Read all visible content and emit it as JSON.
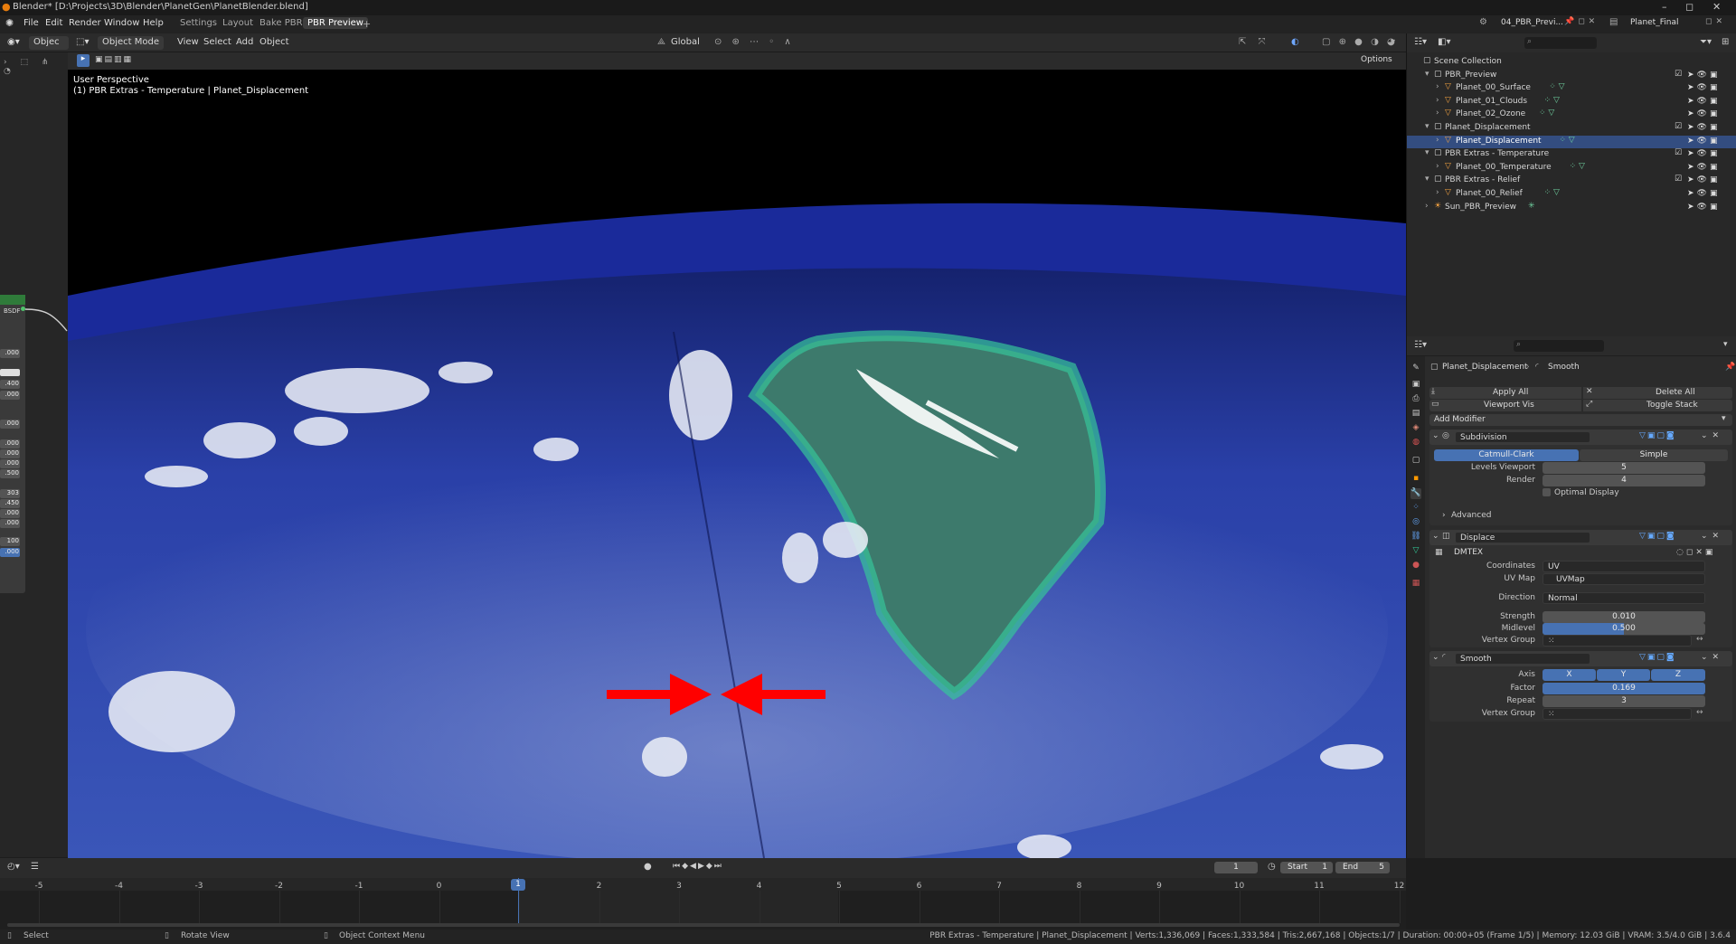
{
  "window": {
    "title": "Blender* [D:\\Projects\\3D\\Blender\\PlanetGen\\PlanetBlender.blend]",
    "minimize": "–",
    "maximize": "◻",
    "close": "✕"
  },
  "menubar": {
    "items": [
      "File",
      "Edit",
      "Render",
      "Window",
      "Help"
    ],
    "workspaces": [
      "Settings",
      "Layout",
      "Bake PBR",
      "PBR Preview"
    ],
    "active_workspace": "PBR Preview",
    "add_tab": "+",
    "scene_name": "04_PBR_Previ...",
    "view_layer": "Planet_Final"
  },
  "viewport_header": {
    "mode": "Object Mode",
    "mode_short": "Objec",
    "view": "View",
    "select": "Select",
    "add": "Add",
    "object": "Object",
    "transform_orientation": "Global",
    "options": "Options"
  },
  "viewport": {
    "perspective_label": "User Perspective",
    "object_label": "(1) PBR Extras - Temperature | Planet_Displacement"
  },
  "node_editor_strip": {
    "socket_label": "BSDF",
    "values": [
      ".000",
      ".400",
      ".000",
      ".000",
      ".000",
      ".000",
      ".000",
      ".500",
      "303",
      ".450",
      ".000",
      ".000",
      "100",
      ".000"
    ]
  },
  "outliner": {
    "search_placeholder": "",
    "rows": [
      {
        "label": "Scene Collection",
        "indent": 0,
        "type": "scene"
      },
      {
        "label": "PBR_Preview",
        "indent": 1,
        "type": "collection"
      },
      {
        "label": "Planet_00_Surface",
        "indent": 2,
        "type": "object"
      },
      {
        "label": "Planet_01_Clouds",
        "indent": 2,
        "type": "object"
      },
      {
        "label": "Planet_02_Ozone",
        "indent": 2,
        "type": "object"
      },
      {
        "label": "Planet_Displacement",
        "indent": 1,
        "type": "collection"
      },
      {
        "label": "Planet_Displacement",
        "indent": 2,
        "type": "object",
        "selected": true
      },
      {
        "label": "PBR Extras - Temperature",
        "indent": 1,
        "type": "collection"
      },
      {
        "label": "Planet_00_Temperature",
        "indent": 2,
        "type": "object"
      },
      {
        "label": "PBR Extras - Relief",
        "indent": 1,
        "type": "collection"
      },
      {
        "label": "Planet_00_Relief",
        "indent": 2,
        "type": "object"
      },
      {
        "label": "Sun_PBR_Preview",
        "indent": 1,
        "type": "light"
      }
    ]
  },
  "properties": {
    "breadcrumb_object": "Planet_Displacement",
    "breadcrumb_modifier": "Smooth",
    "apply_all": "Apply All",
    "delete_all": "Delete All",
    "viewport_vis": "Viewport Vis",
    "toggle_stack": "Toggle Stack",
    "add_modifier": "Add Modifier",
    "subdivision": {
      "name": "Subdivision",
      "catmull_clark": "Catmull-Clark",
      "simple": "Simple",
      "levels_viewport_label": "Levels Viewport",
      "levels_viewport": "5",
      "render_label": "Render",
      "render": "4",
      "optimal_display": "Optimal Display",
      "advanced": "Advanced"
    },
    "displace": {
      "name": "Displace",
      "texture": "DMTEX",
      "coordinates_label": "Coordinates",
      "coordinates": "UV",
      "uv_map_label": "UV Map",
      "uv_map": "UVMap",
      "direction_label": "Direction",
      "direction": "Normal",
      "strength_label": "Strength",
      "strength": "0.010",
      "midlevel_label": "Midlevel",
      "midlevel": "0.500",
      "midlevel_fraction": 0.5,
      "vertex_group_label": "Vertex Group"
    },
    "smooth": {
      "name": "Smooth",
      "axis_label": "Axis",
      "axes": [
        "X",
        "Y",
        "Z"
      ],
      "factor_label": "Factor",
      "factor": "0.169",
      "repeat_label": "Repeat",
      "repeat": "3",
      "vertex_group_label": "Vertex Group"
    }
  },
  "timeline": {
    "current_frame": "1",
    "start_label": "Start",
    "start": "1",
    "end_label": "End",
    "end": "5",
    "ticks": [
      "-5",
      "-4",
      "-3",
      "-2",
      "-1",
      "0",
      "1",
      "2",
      "3",
      "4",
      "5",
      "6",
      "7",
      "8",
      "9",
      "10",
      "11",
      "12"
    ]
  },
  "statusbar": {
    "select": "Select",
    "rotate_view": "Rotate View",
    "context_menu": "Object Context Menu",
    "stats": "PBR Extras - Temperature | Planet_Displacement | Verts:1,336,069 | Faces:1,333,584 | Tris:2,667,168 | Objects:1/7 | Duration: 00:00+05 (Frame 1/5) | Memory: 12.03 GiB | VRAM: 3.5/4.0 GiB | 3.6.4"
  },
  "colors": {
    "selection": "#334d80",
    "field_blue": "#4772b3",
    "arrow_red": "#ff0000",
    "ocean": "#1f3aa0"
  }
}
